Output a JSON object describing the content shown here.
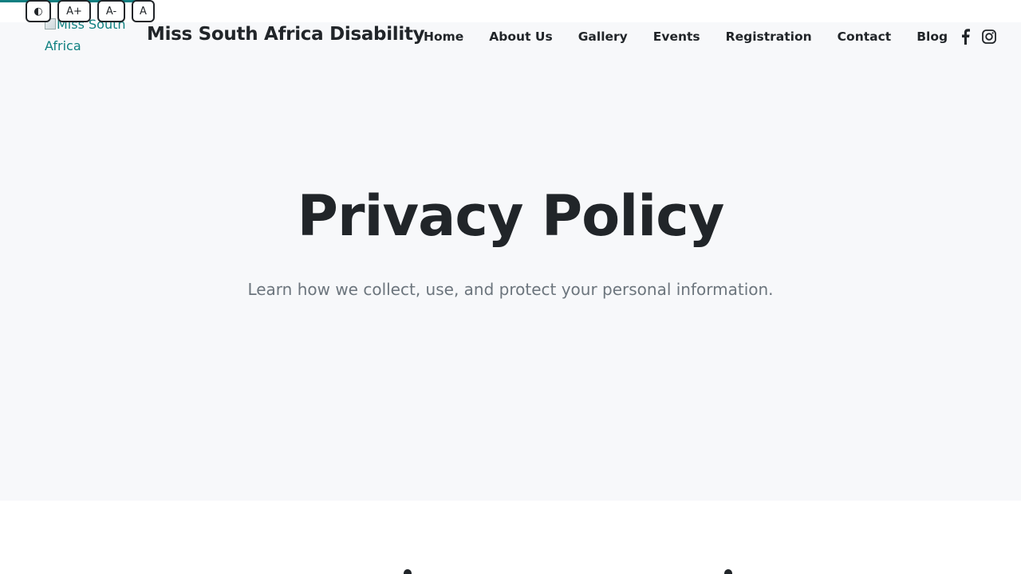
{
  "accessibility_toolbar": {
    "contrast_label": "◐",
    "increase_font_label": "A+",
    "decrease_font_label": "A-",
    "reset_font_label": "A"
  },
  "header": {
    "logo_alt": "Miss South Africa",
    "site_title": "Miss South Africa Disability",
    "nav": [
      {
        "label": "Home"
      },
      {
        "label": "About Us"
      },
      {
        "label": "Gallery"
      },
      {
        "label": "Events"
      },
      {
        "label": "Registration"
      },
      {
        "label": "Contact"
      },
      {
        "label": "Blog"
      }
    ],
    "social_icons": [
      "facebook-icon",
      "instagram-icon"
    ]
  },
  "hero": {
    "title": "Privacy Policy",
    "subtitle": "Learn how we collect, use, and protect your personal information."
  },
  "colors": {
    "accent": "#0f7f80",
    "text": "#212529",
    "muted": "#6c757d",
    "hero_bg": "#f7f8fa"
  }
}
